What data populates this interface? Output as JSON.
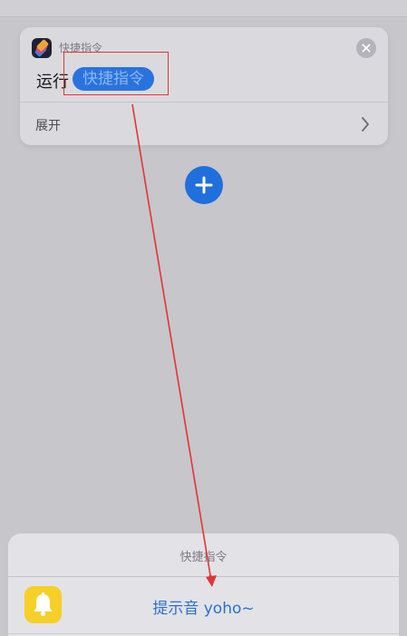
{
  "action_card": {
    "app_label": "快捷指令",
    "run_label": "运行",
    "token_label": "快捷指令",
    "expand_label": "展开"
  },
  "sheet": {
    "title": "快捷指令",
    "items": [
      {
        "label": "提示音 yoho~",
        "icon": "bell-icon"
      }
    ]
  },
  "colors": {
    "accent_blue": "#1f6fdc",
    "highlight_red": "#e23434",
    "bell_yellow": "#f6cf28"
  }
}
